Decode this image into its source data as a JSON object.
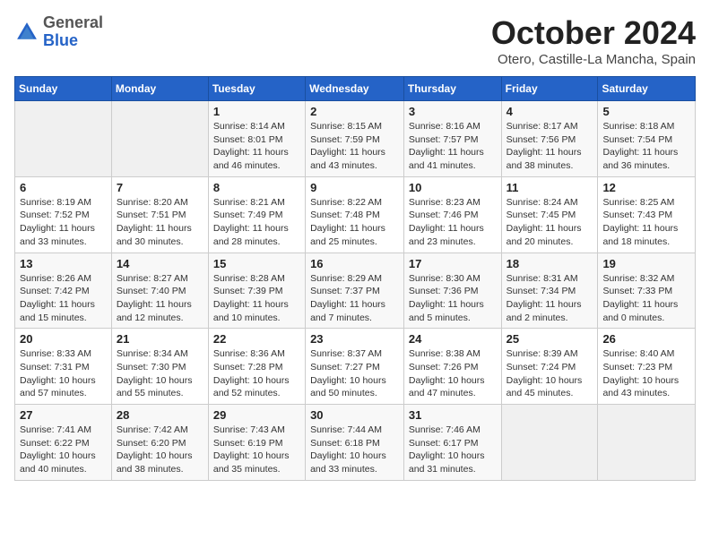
{
  "header": {
    "logo_general": "General",
    "logo_blue": "Blue",
    "month_title": "October 2024",
    "subtitle": "Otero, Castille-La Mancha, Spain"
  },
  "days_of_week": [
    "Sunday",
    "Monday",
    "Tuesday",
    "Wednesday",
    "Thursday",
    "Friday",
    "Saturday"
  ],
  "weeks": [
    [
      {
        "day": "",
        "empty": true
      },
      {
        "day": "",
        "empty": true
      },
      {
        "day": "1",
        "sunrise": "8:14 AM",
        "sunset": "8:01 PM",
        "daylight": "11 hours and 46 minutes."
      },
      {
        "day": "2",
        "sunrise": "8:15 AM",
        "sunset": "7:59 PM",
        "daylight": "11 hours and 43 minutes."
      },
      {
        "day": "3",
        "sunrise": "8:16 AM",
        "sunset": "7:57 PM",
        "daylight": "11 hours and 41 minutes."
      },
      {
        "day": "4",
        "sunrise": "8:17 AM",
        "sunset": "7:56 PM",
        "daylight": "11 hours and 38 minutes."
      },
      {
        "day": "5",
        "sunrise": "8:18 AM",
        "sunset": "7:54 PM",
        "daylight": "11 hours and 36 minutes."
      }
    ],
    [
      {
        "day": "6",
        "sunrise": "8:19 AM",
        "sunset": "7:52 PM",
        "daylight": "11 hours and 33 minutes."
      },
      {
        "day": "7",
        "sunrise": "8:20 AM",
        "sunset": "7:51 PM",
        "daylight": "11 hours and 30 minutes."
      },
      {
        "day": "8",
        "sunrise": "8:21 AM",
        "sunset": "7:49 PM",
        "daylight": "11 hours and 28 minutes."
      },
      {
        "day": "9",
        "sunrise": "8:22 AM",
        "sunset": "7:48 PM",
        "daylight": "11 hours and 25 minutes."
      },
      {
        "day": "10",
        "sunrise": "8:23 AM",
        "sunset": "7:46 PM",
        "daylight": "11 hours and 23 minutes."
      },
      {
        "day": "11",
        "sunrise": "8:24 AM",
        "sunset": "7:45 PM",
        "daylight": "11 hours and 20 minutes."
      },
      {
        "day": "12",
        "sunrise": "8:25 AM",
        "sunset": "7:43 PM",
        "daylight": "11 hours and 18 minutes."
      }
    ],
    [
      {
        "day": "13",
        "sunrise": "8:26 AM",
        "sunset": "7:42 PM",
        "daylight": "11 hours and 15 minutes."
      },
      {
        "day": "14",
        "sunrise": "8:27 AM",
        "sunset": "7:40 PM",
        "daylight": "11 hours and 12 minutes."
      },
      {
        "day": "15",
        "sunrise": "8:28 AM",
        "sunset": "7:39 PM",
        "daylight": "11 hours and 10 minutes."
      },
      {
        "day": "16",
        "sunrise": "8:29 AM",
        "sunset": "7:37 PM",
        "daylight": "11 hours and 7 minutes."
      },
      {
        "day": "17",
        "sunrise": "8:30 AM",
        "sunset": "7:36 PM",
        "daylight": "11 hours and 5 minutes."
      },
      {
        "day": "18",
        "sunrise": "8:31 AM",
        "sunset": "7:34 PM",
        "daylight": "11 hours and 2 minutes."
      },
      {
        "day": "19",
        "sunrise": "8:32 AM",
        "sunset": "7:33 PM",
        "daylight": "11 hours and 0 minutes."
      }
    ],
    [
      {
        "day": "20",
        "sunrise": "8:33 AM",
        "sunset": "7:31 PM",
        "daylight": "10 hours and 57 minutes."
      },
      {
        "day": "21",
        "sunrise": "8:34 AM",
        "sunset": "7:30 PM",
        "daylight": "10 hours and 55 minutes."
      },
      {
        "day": "22",
        "sunrise": "8:36 AM",
        "sunset": "7:28 PM",
        "daylight": "10 hours and 52 minutes."
      },
      {
        "day": "23",
        "sunrise": "8:37 AM",
        "sunset": "7:27 PM",
        "daylight": "10 hours and 50 minutes."
      },
      {
        "day": "24",
        "sunrise": "8:38 AM",
        "sunset": "7:26 PM",
        "daylight": "10 hours and 47 minutes."
      },
      {
        "day": "25",
        "sunrise": "8:39 AM",
        "sunset": "7:24 PM",
        "daylight": "10 hours and 45 minutes."
      },
      {
        "day": "26",
        "sunrise": "8:40 AM",
        "sunset": "7:23 PM",
        "daylight": "10 hours and 43 minutes."
      }
    ],
    [
      {
        "day": "27",
        "sunrise": "7:41 AM",
        "sunset": "6:22 PM",
        "daylight": "10 hours and 40 minutes."
      },
      {
        "day": "28",
        "sunrise": "7:42 AM",
        "sunset": "6:20 PM",
        "daylight": "10 hours and 38 minutes."
      },
      {
        "day": "29",
        "sunrise": "7:43 AM",
        "sunset": "6:19 PM",
        "daylight": "10 hours and 35 minutes."
      },
      {
        "day": "30",
        "sunrise": "7:44 AM",
        "sunset": "6:18 PM",
        "daylight": "10 hours and 33 minutes."
      },
      {
        "day": "31",
        "sunrise": "7:46 AM",
        "sunset": "6:17 PM",
        "daylight": "10 hours and 31 minutes."
      },
      {
        "day": "",
        "empty": true
      },
      {
        "day": "",
        "empty": true
      }
    ]
  ]
}
